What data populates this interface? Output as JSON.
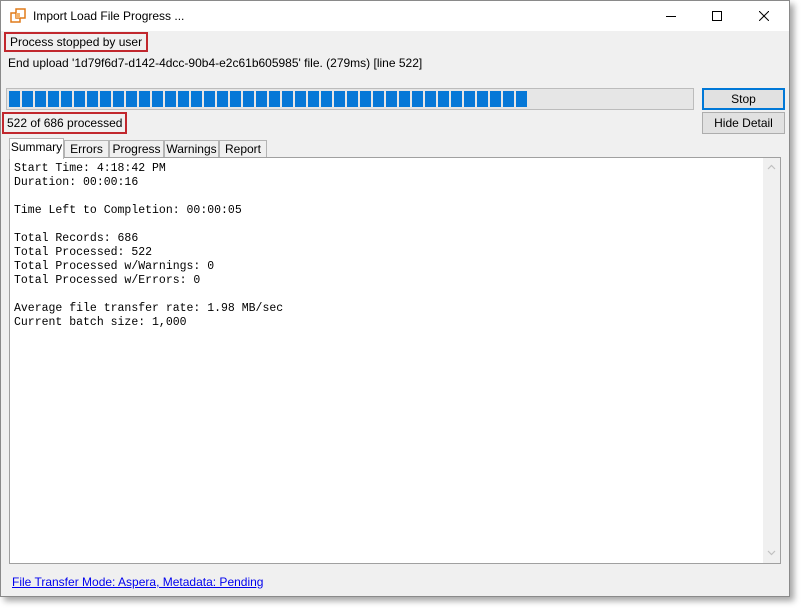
{
  "window": {
    "title": "Import Load File Progress ...",
    "controls": [
      "minimize",
      "maximize",
      "close"
    ]
  },
  "status": {
    "message": "Process stopped by user",
    "detail": "End upload '1d79f6d7-d142-4dcc-90b4-e2c61b605985' file. (279ms) [line 522]",
    "count_text": "522 of 686 processed"
  },
  "progress": {
    "processed": 522,
    "total": 686,
    "fraction": 0.761,
    "color": "#0678d7"
  },
  "buttons": {
    "stop": "Stop",
    "hide_detail": "Hide Detail"
  },
  "tabs": [
    {
      "label": "Summary",
      "active": true
    },
    {
      "label": "Errors",
      "active": false
    },
    {
      "label": "Progress",
      "active": false
    },
    {
      "label": "Warnings",
      "active": false
    },
    {
      "label": "Report",
      "active": false
    }
  ],
  "summary": {
    "start_time": "Start Time: 4:18:42 PM",
    "duration": "Duration: 00:00:16",
    "time_left": "Time Left to Completion: 00:00:05",
    "total_records": "Total Records: 686",
    "total_processed": "Total Processed: 522",
    "warnings": "Total Processed w/Warnings: 0",
    "errors": "Total Processed w/Errors: 0",
    "transfer_rate": "Average file transfer rate: 1.98 MB/sec",
    "batch_size": "Current batch size: 1,000"
  },
  "footer": {
    "link": "File Transfer Mode: Aspera, Metadata: Pending"
  },
  "colors": {
    "highlight_border": "#c1272d",
    "link": "#0000ee"
  }
}
